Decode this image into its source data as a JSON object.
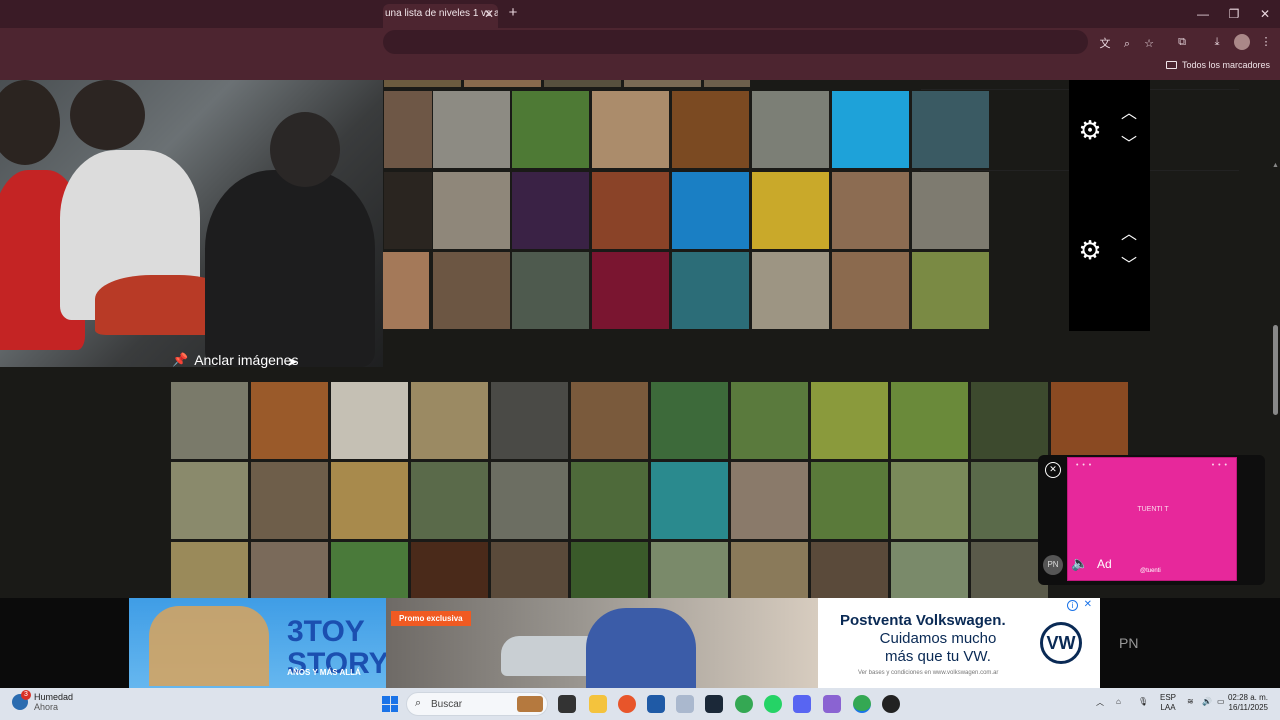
{
  "browser": {
    "tab_title": "una lista de niveles 1 vs a",
    "new_tab_symbol": "+",
    "bookmarks_folder": "Todos los marcadores"
  },
  "tier_controls": {
    "rows": [
      {
        "gear": "gear-icon",
        "up": "chevron-up-icon",
        "down": "chevron-down-icon"
      },
      {
        "gear": "gear-icon",
        "up": "chevron-up-icon",
        "down": "chevron-down-icon"
      }
    ]
  },
  "anchor": {
    "label": "Anclar imágenes"
  },
  "colors": {
    "background": "#1a1a17",
    "tier_label_lime": "#c4fb6d",
    "title_bar": "#3a1b26",
    "toolbar": "#4d2530",
    "pink_ad": "#e7289b"
  },
  "overlay_ad": {
    "title": "TUENTI T",
    "brand": "@tuenti",
    "pn_badge": "PN",
    "ad_label": "Ad",
    "dots": "• • •"
  },
  "bottom_ads": {
    "toy_story": {
      "logo": "3TOY STORY",
      "subtitle": "AÑOS Y MÁS ALLÁ"
    },
    "promo": {
      "tag": "Promo exclusiva"
    },
    "vw": {
      "headline": "Postventa Volkswagen.",
      "line1": "Cuidamos mucho",
      "line2": "más que tu VW.",
      "legal": "Ver bases y condiciones en www.volkswagen.com.ar",
      "logo": "VW"
    },
    "pn_text": "PN"
  },
  "taskbar": {
    "weather_label": "Humedad",
    "weather_sub": "Ahora",
    "weather_badge": "3",
    "search_placeholder": "Buscar",
    "lang_top": "ESP",
    "lang_bottom": "LAA",
    "time": "02:28 a. m.",
    "date": "16/11/2025"
  }
}
